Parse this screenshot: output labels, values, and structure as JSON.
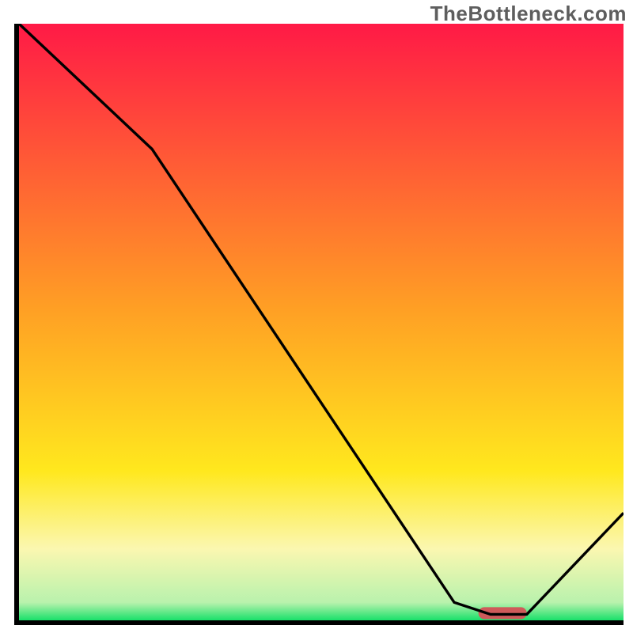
{
  "watermark": "TheBottleneck.com",
  "chart_data": {
    "type": "line",
    "title": "",
    "xlabel": "",
    "ylabel": "",
    "xlim": [
      0,
      100
    ],
    "ylim": [
      0,
      100
    ],
    "series": [
      {
        "name": "curve",
        "x": [
          0,
          22,
          72,
          78,
          84,
          100
        ],
        "y": [
          100,
          79,
          3,
          1,
          1,
          18
        ]
      }
    ],
    "marker": {
      "x": 80,
      "width": 8,
      "y": 1,
      "color": "#cf5a5a"
    },
    "background_gradient": [
      {
        "stop": 0.0,
        "color": "#ff1a46"
      },
      {
        "stop": 0.48,
        "color": "#ffa024"
      },
      {
        "stop": 0.75,
        "color": "#ffe81e"
      },
      {
        "stop": 0.88,
        "color": "#fbf7b0"
      },
      {
        "stop": 0.97,
        "color": "#b9f2ad"
      },
      {
        "stop": 1.0,
        "color": "#18e06a"
      }
    ]
  }
}
